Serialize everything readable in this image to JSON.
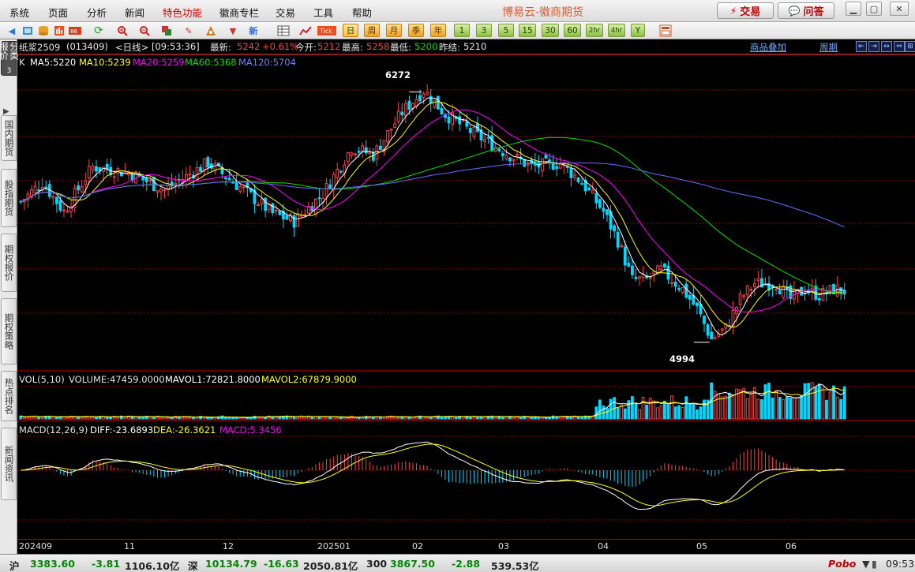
{
  "menubar": {
    "items": [
      "系统",
      "页面",
      "分析",
      "新闻",
      "特色功能",
      "徽商专栏",
      "交易",
      "工具",
      "帮助"
    ],
    "brand": "博易云-徽商期货",
    "trade_button": "交易",
    "ask_button": "问答"
  },
  "toolbar": {
    "period_buttons": [
      "日",
      "周",
      "月",
      "季",
      "年",
      "1",
      "3",
      "5",
      "15",
      "30",
      "60",
      "2hr",
      "4hr",
      "Y"
    ],
    "selected_period": "日",
    "tick_label": "Tick"
  },
  "sidetabs": [
    {
      "label": "分类报价",
      "num": "3"
    },
    {
      "label": "国内期货"
    },
    {
      "label": "股指期货"
    },
    {
      "label": "期权报价"
    },
    {
      "label": "期权策略"
    },
    {
      "label": "热点排名"
    },
    {
      "label": "新闻资讯"
    }
  ],
  "quote": {
    "symbol": "纸浆2509",
    "code": "(013409)",
    "period": "<日线>",
    "time": "[09:53:36]",
    "last_label": "最新:",
    "last": "5242",
    "change": "+0.61%",
    "open_label": "今开:",
    "open": "5212",
    "high_label": "最高:",
    "high": "5258",
    "low_label": "最低:",
    "low": "5200",
    "prev_label": "昨结:",
    "prev": "5210",
    "overlay_link": "商品叠加",
    "cycle_link": "周期"
  },
  "ma_legend": {
    "k": "K",
    "ma5": "MA5:5220",
    "ma10": "MA10:5239",
    "ma20": "MA20:5259",
    "ma60": "MA60:5368",
    "ma120": "MA120:5704"
  },
  "vol_legend": {
    "title": "VOL(5,10)",
    "volume": "VOLUME:47459.0000",
    "mavol1": "MAVOL1:72821.8000",
    "mavol2": "MAVOL2:67879.9000"
  },
  "macd_legend": {
    "title": "MACD(12,26,9)",
    "diff": "DIFF:-23.6893",
    "dea": "DEA:-26.3621",
    "macd": "MACD:5.3456"
  },
  "annotations": {
    "high": "6272",
    "low": "4994"
  },
  "dateaxis": [
    "202409",
    "11",
    "12",
    "202501",
    "02",
    "03",
    "04",
    "05",
    "06"
  ],
  "status": {
    "sh_label": "沪",
    "sh_value": "3383.60",
    "sh_change": "-3.81",
    "sh_amount": "1106.10亿",
    "sz_label": "深",
    "sz_value": "10134.79",
    "sz_change": "-16.63",
    "sz_amount": "2050.81亿",
    "b300_label": "300",
    "b300_value": "3867.50",
    "b300_change": "-2.88",
    "b300_amount": "539.53亿",
    "logo": "Pobo",
    "clock": "09:53"
  },
  "colors": {
    "up": "#ff4040",
    "down": "#00d8ff",
    "ma5": "#ffffff",
    "ma10": "#ffff00",
    "ma20": "#ff00ff",
    "ma60": "#00e000",
    "ma120": "#6a6aff",
    "grid": "#8a0000"
  },
  "chart_data": {
    "type": "candlestick",
    "axes": {
      "x": "date (2024-09 to 2025-06, daily)",
      "y_range": [
        4900,
        6400
      ]
    },
    "ohlc_anchors": [
      {
        "date": "2024-09",
        "close": 5700
      },
      {
        "date": "2024-11",
        "close": 5880
      },
      {
        "date": "2024-12",
        "close": 5800
      },
      {
        "date": "2025-01",
        "close": 5720
      },
      {
        "date": "2025-01-late",
        "close": 6000
      },
      {
        "date": "2025-02",
        "close": 6272
      },
      {
        "date": "2025-03",
        "close": 5900
      },
      {
        "date": "2025-04",
        "close": 5350
      },
      {
        "date": "2025-05",
        "close": 4994
      },
      {
        "date": "2025-06",
        "close": 5242
      }
    ],
    "high_marker": 6272,
    "low_marker": 4994,
    "moving_averages": {
      "MA5": 5220,
      "MA10": 5239,
      "MA20": 5259,
      "MA60": 5368,
      "MA120": 5704
    },
    "volume": {
      "last": 47459,
      "MAVOL1": 72821.8,
      "MAVOL2": 67879.9
    },
    "macd": {
      "DIFF": -23.6893,
      "DEA": -26.3621,
      "MACD": 5.3456
    }
  }
}
